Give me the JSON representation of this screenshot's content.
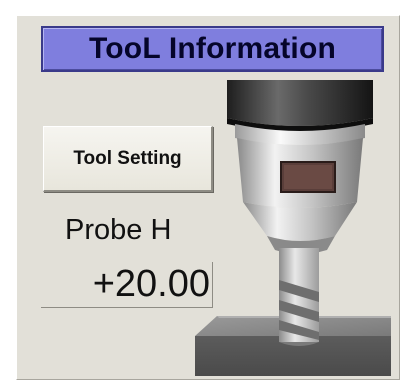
{
  "panel": {
    "title": "TooL Information",
    "tool_setting_button": "Tool Setting",
    "probe": {
      "label": "Probe H",
      "value": "+20.00"
    }
  },
  "graphic": {
    "icon": "milling-tool-icon"
  },
  "colors": {
    "panel_background": "#e2e0d8",
    "title_background": "#7f7ede",
    "title_text": "#05052a",
    "button_background": "#f3f2ec",
    "tool_steel": "#b0b0b0",
    "spindle_dark": "#3a3a3a",
    "indicator_window": "#5a3e3a",
    "workpiece": "#7c7c7c"
  }
}
